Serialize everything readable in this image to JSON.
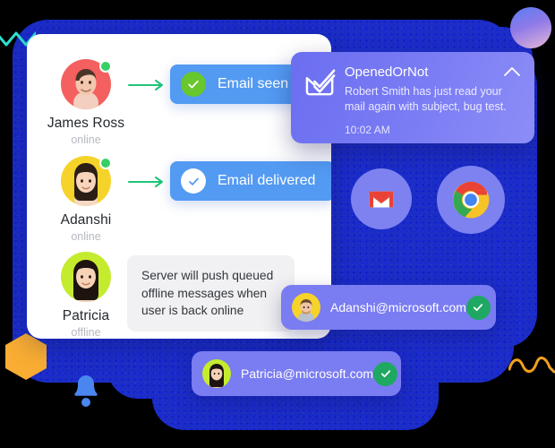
{
  "people": [
    {
      "name": "James Ross",
      "status": "online",
      "avatar_bg": "#f4605f",
      "status_color": "#36d065",
      "badge": {
        "label": "Email seen",
        "icon": "check-circle-icon",
        "badge_style": "green",
        "pill_color": "#539af2"
      }
    },
    {
      "name": "Adanshi",
      "status": "online",
      "avatar_bg": "#f6d32a",
      "status_color": "#36d065",
      "badge": {
        "label": "Email delivered",
        "icon": "check-circle-icon",
        "badge_style": "white",
        "pill_color": "#539af2"
      }
    },
    {
      "name": "Patricia",
      "status": "offline",
      "avatar_bg": "#c4eb2e",
      "status_color": "",
      "message": "Server will push queued offline messages when user is back online"
    }
  ],
  "notification": {
    "icon": "envelope-check-icon",
    "title": "OpenedOrNot",
    "body": "Robert Smith has just read your mail again with subject, bug test.",
    "time": "10:02 AM",
    "collapse_icon": "chevron-up-icon",
    "bg_color": "#7b7df4"
  },
  "app_icons": [
    {
      "name": "gmail-icon",
      "label": "Gmail"
    },
    {
      "name": "chrome-icon",
      "label": "Chrome"
    }
  ],
  "email_chips": [
    {
      "email": "Adanshi@microsoft.com",
      "check_icon": "check-icon",
      "check_color": "#1fa862",
      "avatar_bg": "#f6d32a"
    },
    {
      "email": "Patricia@microsoft.com",
      "check_icon": "check-icon",
      "check_color": "#1fa862",
      "avatar_bg": "#c4eb2e"
    }
  ],
  "decorations": [
    {
      "name": "gradient-circle",
      "colors": [
        "#5b7cf5",
        "#e9b9d8"
      ]
    },
    {
      "name": "orange-hexagon",
      "color": "#f9ad33"
    },
    {
      "name": "bell-icon",
      "color": "#4a86ef"
    },
    {
      "name": "teal-zigzag",
      "color": "#2fe0d0"
    },
    {
      "name": "orange-squiggle",
      "color": "#f0a01e"
    }
  ],
  "theme": {
    "backdrop": "#1d2ec4",
    "card_bg": "#ffffff",
    "arrow_color": "#1fc47a"
  }
}
